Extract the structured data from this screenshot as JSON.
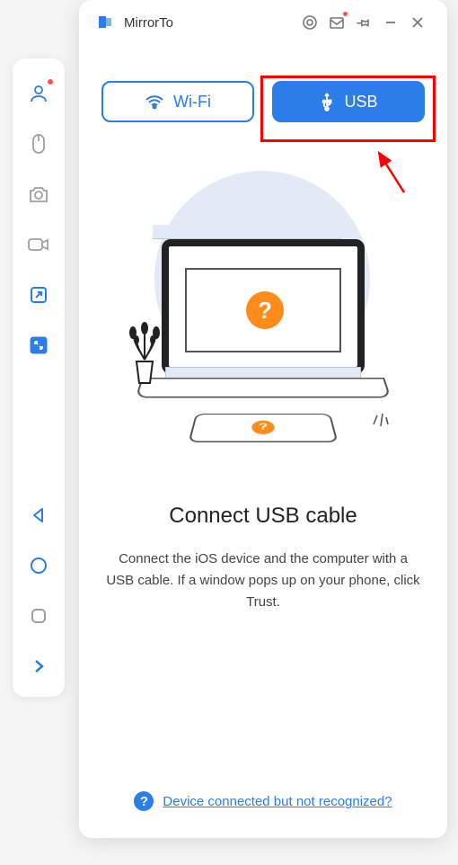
{
  "app": {
    "title": "MirrorTo"
  },
  "tabs": {
    "wifi_label": "Wi-Fi",
    "usb_label": "USB"
  },
  "content": {
    "heading": "Connect USB cable",
    "description": "Connect the iOS device and the computer with a USB cable. If a window pops up on your phone, click Trust."
  },
  "footer": {
    "help_link": "Device connected but not recognized?"
  },
  "colors": {
    "primary": "#2b7de9",
    "accent": "#ff8c1a",
    "highlight": "#ff0000"
  }
}
